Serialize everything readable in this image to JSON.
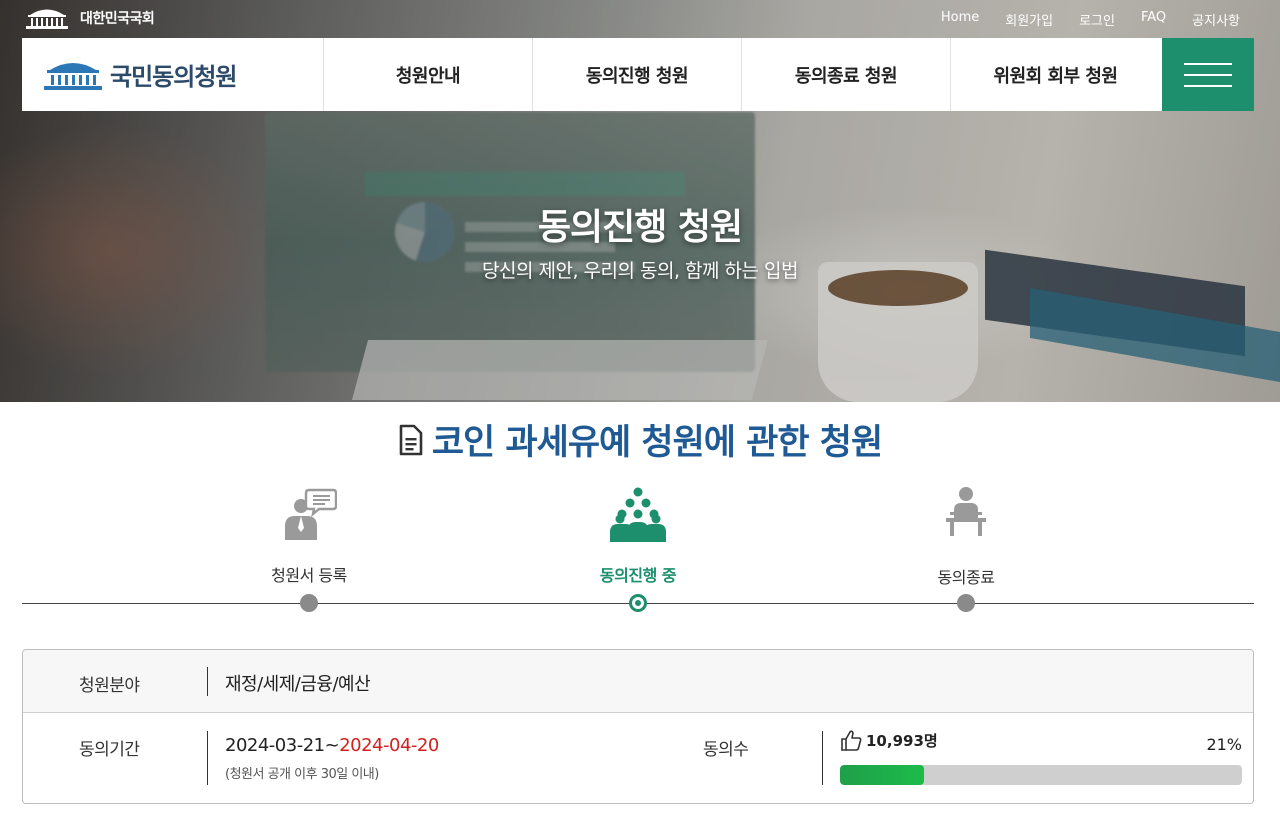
{
  "top": {
    "assembly_name": "대한민국국회",
    "links": [
      "Home",
      "회원가입",
      "로그인",
      "FAQ",
      "공지사항"
    ]
  },
  "nav": {
    "brand": "국민동의청원",
    "items": [
      "청원안내",
      "동의진행 청원",
      "동의종료 청원",
      "위원회 회부 청원"
    ]
  },
  "hero": {
    "title": "동의진행 청원",
    "subtitle": "당신의 제안, 우리의 동의, 함께 하는 입법"
  },
  "petition": {
    "title": "코인 과세유예 청원에 관한 청원"
  },
  "steps": [
    {
      "label": "청원서 등록",
      "icon": "speech-person-icon",
      "active": false
    },
    {
      "label": "동의진행 중",
      "icon": "group-people-icon",
      "active": true
    },
    {
      "label": "동의종료",
      "icon": "podium-person-icon",
      "active": false
    }
  ],
  "info": {
    "category_label": "청원분야",
    "category_value": "재정/세제/금융/예산",
    "period_label": "동의기간",
    "period_start": "2024-03-21",
    "period_sep": "~",
    "period_end": "2024-04-20",
    "period_note": "(청원서 공개 이후 30일 이내)",
    "agree_label": "동의수",
    "agree_count": "10,993명",
    "agree_percent": "21%",
    "agree_ratio": 0.21
  },
  "colors": {
    "brand_green": "#1d8f6c",
    "title_blue": "#1f5a94",
    "end_date_red": "#d32020"
  }
}
